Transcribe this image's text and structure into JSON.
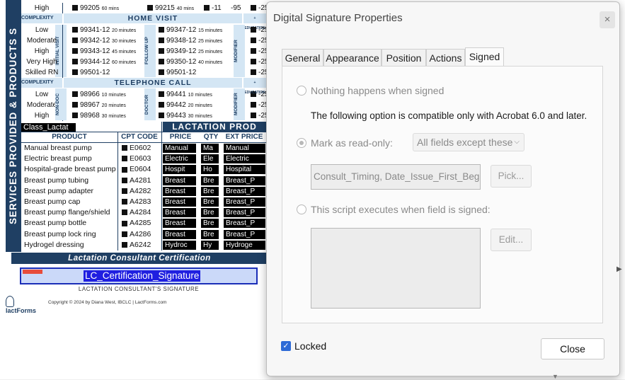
{
  "document": {
    "sidebar_text": "SERVICES PROVIDED & PRODUCTS S",
    "top_row": {
      "label": "High",
      "code1": "99205",
      "time1": "60 mins",
      "code2": "99215",
      "time2": "40 mins",
      "mod1": "-11",
      "mod2": "-95",
      "mod3": "-25"
    },
    "complexity_label": "COMPLEXITY",
    "education_label": "EDUCATION",
    "home_visit": {
      "title": "HOME VISIT",
      "side_initial": "INITIAL VISIT",
      "side_follow": "FOLLOW UP",
      "side_modifier": "MODIFIER",
      "rows": [
        {
          "label": "Low",
          "code1": "99341-12",
          "time1": "20 minutes",
          "code2": "99347-12",
          "time2": "15 minutes",
          "mod": "-25"
        },
        {
          "label": "Moderate",
          "code1": "99342-12",
          "time1": "30 minutes",
          "code2": "99348-12",
          "time2": "25 minutes",
          "mod": "-25"
        },
        {
          "label": "High",
          "code1": "99343-12",
          "time1": "45 minutes",
          "code2": "99349-12",
          "time2": "25 minutes",
          "mod": "-25"
        },
        {
          "label": "Very High",
          "code1": "99344-12",
          "time1": "60 minutes",
          "code2": "99350-12",
          "time2": "40 minutes",
          "mod": "-25"
        },
        {
          "label": "Skilled RN",
          "code1": "99501-12",
          "time1": "",
          "code2": "99501-12",
          "time2": "",
          "mod": "-25"
        }
      ]
    },
    "telephone_call": {
      "title": "TELEPHONE CALL",
      "side_left": "NON-DOC",
      "side_right": "DOCTOR",
      "side_modifier": "MODIFIER",
      "rows": [
        {
          "label": "Low",
          "code1": "98966",
          "time1": "10 minutes",
          "code2": "99441",
          "time2": "10 minutes",
          "mod": "-25"
        },
        {
          "label": "Moderate",
          "code1": "98967",
          "time1": "20 minutes",
          "code2": "99442",
          "time2": "20 minutes",
          "mod": "-25"
        },
        {
          "label": "High",
          "code1": "98968",
          "time1": "30 minutes",
          "code2": "99443",
          "time2": "30 minutes",
          "mod": "-25"
        }
      ]
    },
    "class_label": "Class_Lactat",
    "lactation_products": "LACTATION PROD",
    "product_headers": {
      "product": "PRODUCT",
      "cpt": "CPT CODE",
      "price": "PRICE",
      "qty": "QTY",
      "ext": "EXT PRICE"
    },
    "products": [
      {
        "name": "Manual breast pump",
        "code": "E0602",
        "price": "Manual",
        "qty": "Ma",
        "ext": "Manual"
      },
      {
        "name": "Electric breast pump",
        "code": "E0603",
        "price": "Electric",
        "qty": "Ele",
        "ext": "Electric"
      },
      {
        "name": "Hospital-grade breast pump",
        "code": "E0604",
        "price": "Hospit",
        "qty": "Ho",
        "ext": "Hospital"
      },
      {
        "name": "Breast pump tubing",
        "code": "A4281",
        "price": "Breast",
        "qty": "Bre",
        "ext": "Breast_P"
      },
      {
        "name": "Breast pump adapter",
        "code": "A4282",
        "price": "Breast",
        "qty": "Bre",
        "ext": "Breast_P"
      },
      {
        "name": "Breast pump cap",
        "code": "A4283",
        "price": "Breast",
        "qty": "Bre",
        "ext": "Breast_P"
      },
      {
        "name": "Breast pump flange/shield",
        "code": "A4284",
        "price": "Breast",
        "qty": "Bre",
        "ext": "Breast_P"
      },
      {
        "name": "Breast pump bottle",
        "code": "A4285",
        "price": "Breast",
        "qty": "Bre",
        "ext": "Breast_P"
      },
      {
        "name": "Breast pump lock ring",
        "code": "A4286",
        "price": "Breast",
        "qty": "Bre",
        "ext": "Breast_P"
      },
      {
        "name": "Hydrogel dressing",
        "code": "A6242",
        "price": "Hydroc",
        "qty": "Hy",
        "ext": "Hydroge"
      }
    ],
    "certification_title": "Lactation Consultant Certification",
    "signature_field": "LC_Certification_Signature",
    "signature_label": "LACTATION CONSULTANT'S SIGNATURE",
    "logo_text": "lactForms",
    "copyright": "Copyright © 2024 by Diana West, IBCLC | LactForms.com"
  },
  "dialog": {
    "title": "Digital Signature Properties",
    "close_x": "×",
    "tabs": [
      "General",
      "Appearance",
      "Position",
      "Actions",
      "Signed"
    ],
    "active_tab": "Signed",
    "option_nothing": "Nothing happens when signed",
    "compat_note": "The following option is compatible only with Acrobat 6.0 and later.",
    "option_readonly": "Mark as read-only:",
    "readonly_select": "All fields except these",
    "fields_value": "Consult_Timing, Date_Issue_First_Began",
    "pick_button": "Pick...",
    "option_script": "This script executes when field is signed:",
    "edit_button": "Edit...",
    "locked_label": "Locked",
    "close_button": "Close",
    "checkmark": "✓"
  }
}
